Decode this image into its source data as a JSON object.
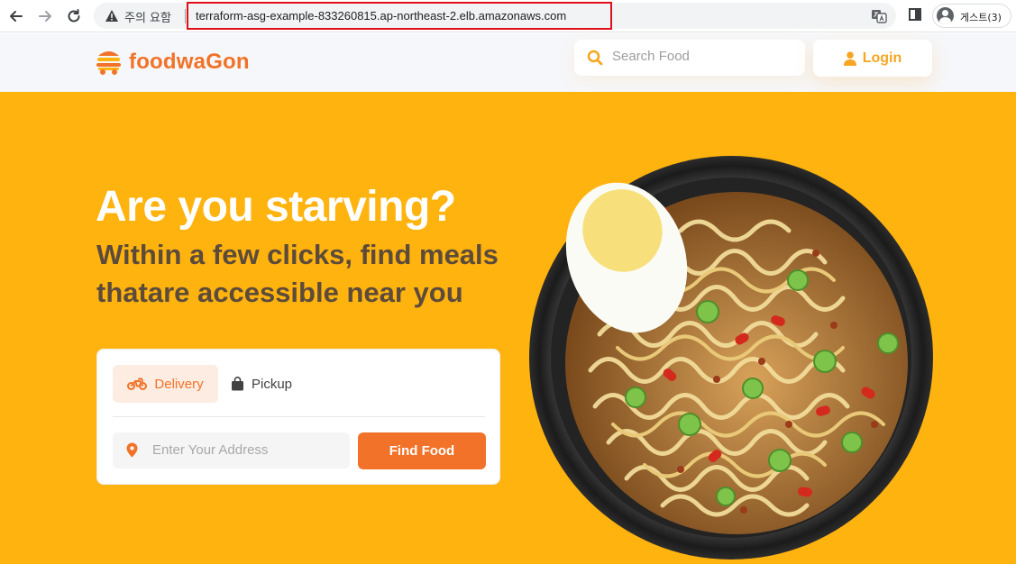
{
  "browser": {
    "security_label": "주의 요함",
    "url": "terraform-asg-example-833260815.ap-northeast-2.elb.amazonaws.com",
    "profile_label": "게스트(3)"
  },
  "header": {
    "logo_text": "foodwaGon",
    "search_placeholder": "Search Food",
    "login_label": "Login"
  },
  "hero": {
    "headline": "Are you starving?",
    "subline_1": "Within a few clicks, find meals",
    "subline_2": "thatare accessible near you"
  },
  "order_card": {
    "tabs": [
      {
        "label": "Delivery",
        "active": true,
        "icon": "motorcycle-icon"
      },
      {
        "label": "Pickup",
        "active": false,
        "icon": "shopping-bag-icon"
      }
    ],
    "address_placeholder": "Enter Your Address",
    "find_button_label": "Find Food"
  },
  "colors": {
    "brand_orange": "#f17228",
    "hero_yellow": "#ffb30e",
    "login_yellow": "#f6a623",
    "dark_text": "#5c4b3b"
  }
}
